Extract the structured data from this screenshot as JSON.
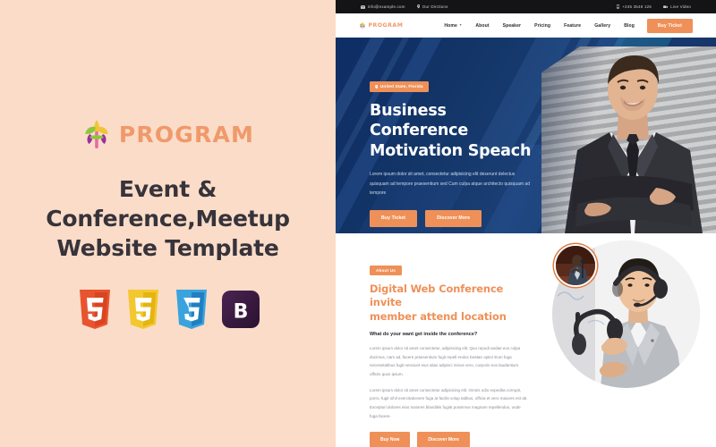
{
  "left_panel": {
    "logo_text": "PROGRAM",
    "logo_icon": "fleur-de-lis-icon",
    "headline_line1": "Event & Conference,Meetup",
    "headline_line2": "Website Template",
    "tech_badges": [
      {
        "name": "html5-badge",
        "label": "5",
        "color": "#e8542f"
      },
      {
        "name": "js-badge",
        "label": "5",
        "color": "#f0bd2e"
      },
      {
        "name": "css3-badge",
        "label": "3",
        "color": "#2f9fdc"
      },
      {
        "name": "bootstrap-badge",
        "label": "B",
        "color": "#3b1d42"
      }
    ],
    "background_color": "#fadcc8",
    "headline_color": "#37333a",
    "logo_color": "#f0996a"
  },
  "preview": {
    "topbar": {
      "email": "info@example.com",
      "directions": "Our Dirctions",
      "phone": "+245 3548 125",
      "live_video": "Live Video",
      "background_color": "#141416"
    },
    "navbar": {
      "brand": "PROGRAM",
      "links": [
        {
          "label": "Home",
          "has_dropdown": true
        },
        {
          "label": "About",
          "has_dropdown": false
        },
        {
          "label": "Speaker",
          "has_dropdown": false
        },
        {
          "label": "Pricing",
          "has_dropdown": false
        },
        {
          "label": "Feature",
          "has_dropdown": false
        },
        {
          "label": "Gallery",
          "has_dropdown": false
        },
        {
          "label": "Blog",
          "has_dropdown": false
        }
      ],
      "cta_label": "Buy Ticket"
    },
    "hero": {
      "badge": "United State, Florida",
      "title_line1": "Business Conference",
      "title_line2": "Motivation Speach",
      "description": "Lorem ipsum dolor sit amet, consectetur adipisicing elit deserunt delectus quisquam ad tempore praesentium sed Cum culpa atque architecto quisquam ad tempore",
      "primary_button": "Buy Ticket",
      "secondary_button": "Discover More",
      "accent_color": "#ef9058",
      "background_color": "#123466"
    },
    "about": {
      "badge": "About Us",
      "title_line1": "Digital Web Conference invite",
      "title_line2": "member attend location",
      "subtitle": "What do your want get inside the conference?",
      "paragraph1": "Lorem ipsum dolor sit amet consectetur, adipisicing elit. Quo repudi andae eos culpa ducimus, nam ad, facere praesentium fugit repell endus beatae optio! Eum fuga necessitatibus fugit nesciunt eius alias adipisci minus vero, corporis eos laudantium officiis quos ipsum.",
      "paragraph2": "Lorem ipsum dolor sit amet consectetur adipisicing elit. Omnis odio expedita corrupti, porro, fugit nihil exercitationem fuga at facilis volup tatibus, officia et vero maiores est ab. Excepturi dolores eius maiores blanditiis fugiat possimus magnam repellendus, unde fuga facere.",
      "primary_button": "Buy Now",
      "secondary_button": "Discover More",
      "title_color": "#ef9058"
    }
  }
}
